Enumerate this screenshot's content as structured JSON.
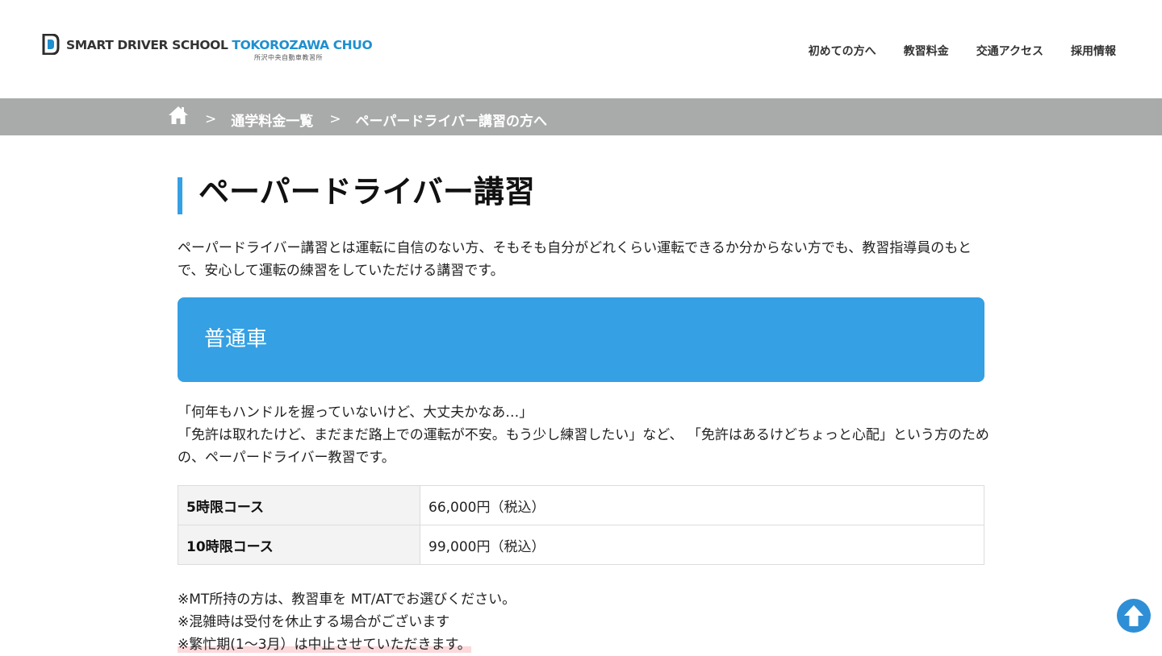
{
  "header": {
    "logo": {
      "main_part1": "SMART DRIVER SCHOOL ",
      "main_part2": "TOKOROZAWA CHUO",
      "sub": "所沢中央自動車教習所"
    },
    "nav": [
      {
        "label": "初めての方へ"
      },
      {
        "label": "教習料金"
      },
      {
        "label": "交通アクセス"
      },
      {
        "label": "採用情報"
      }
    ]
  },
  "breadcrumb": {
    "home_icon": "home-icon",
    "separator": ">",
    "items": [
      {
        "label": "通学料金一覧"
      },
      {
        "label": "ペーパードライバー講習の方へ"
      }
    ]
  },
  "main": {
    "title": "ペーパードライバー講習",
    "intro": "ペーパードライバー講習とは運転に自信のない方、そもそも自分がどれくらい運転できるか分からない方でも、教習指導員のもとで、安心して運転の練習をしていただける講習です。",
    "section": {
      "title": "普通車",
      "desc": [
        "「何年もハンドルを握っていないけど、大丈夫かなあ…」",
        "「免許は取れたけど、まだまだ路上での運転が不安。もう少し練習したい」など、 「免許はあるけどちょっと心配」という方のための、ペーパードライバー教習です。"
      ],
      "prices": [
        {
          "course": "5時限コース",
          "price": "66,000円（税込）"
        },
        {
          "course": "10時限コース",
          "price": "99,000円（税込）"
        }
      ],
      "notes": [
        "※MT所持の方は、教習車を MT/ATでお選びください。",
        "※混雑時は受付を休止する場合がございます",
        "※繁忙期(1〜3月）は中止させていただきます。"
      ]
    }
  },
  "colors": {
    "accent": "#35a0e3",
    "breadcrumb_bg": "#a9aaaa",
    "highlight": "#fcd9da",
    "to_top": "#2e8fd6"
  },
  "icons": {
    "to_top": "arrow-up-icon"
  }
}
